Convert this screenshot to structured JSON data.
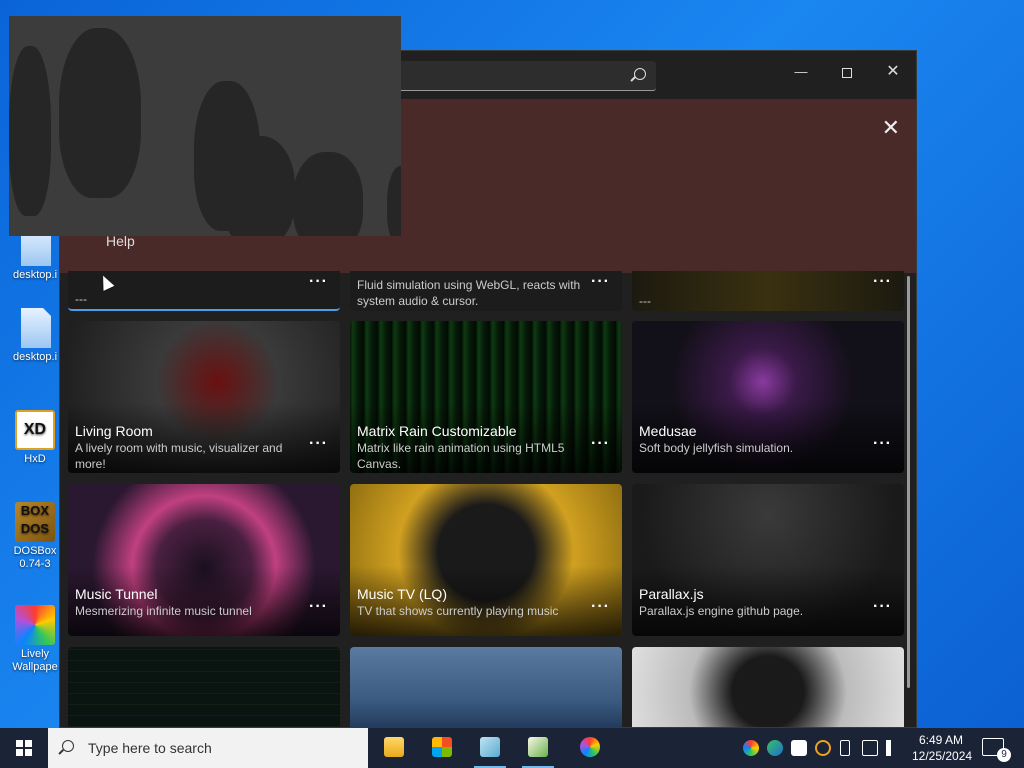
{
  "desktop": {
    "icons": [
      {
        "label": "desktop.i",
        "icon": "file-icon"
      },
      {
        "label": "desktop.i",
        "icon": "file-icon"
      },
      {
        "label": "HxD",
        "icon": "hxd-icon"
      },
      {
        "label": "DOSBox 0.74-3",
        "icon": "dosbox-icon"
      },
      {
        "label": "Lively Wallpape",
        "icon": "lively-icon"
      }
    ]
  },
  "window": {
    "search_placeholder": "",
    "controls": {
      "minimize": "—",
      "maximize": "",
      "close": "✕"
    }
  },
  "banner": {
    "help_label": "Help",
    "close": "✕"
  },
  "top_row": [
    {
      "desc": "---",
      "more": "···"
    },
    {
      "desc": "Fluid simulation using WebGL, reacts with system audio & cursor.",
      "more": "···"
    },
    {
      "desc": "---",
      "more": "···"
    }
  ],
  "cards": [
    {
      "title": "Living Room",
      "desc": "A lively room with music, visualizer and more!",
      "more": "···"
    },
    {
      "title": "Matrix Rain Customizable",
      "desc": "Matrix like rain animation using HTML5 Canvas.",
      "more": "···"
    },
    {
      "title": "Medusae",
      "desc": "Soft body jellyfish simulation.",
      "more": "···"
    },
    {
      "title": "Music Tunnel",
      "desc": "Mesmerizing infinite music tunnel",
      "more": "···"
    },
    {
      "title": "Music TV (LQ)",
      "desc": "TV that shows currently playing music",
      "more": "···"
    },
    {
      "title": "Parallax.js",
      "desc": "Parallax.js engine github page.",
      "more": "···"
    }
  ],
  "taskbar": {
    "search_placeholder": "Type here to search",
    "apps": [
      "file-explorer-icon",
      "store-icon",
      "notepad-icon",
      "spreadsheet-icon",
      "lively-icon"
    ],
    "clock_time": "6:49 AM",
    "clock_date": "12/25/2024",
    "notification_count": "9"
  }
}
